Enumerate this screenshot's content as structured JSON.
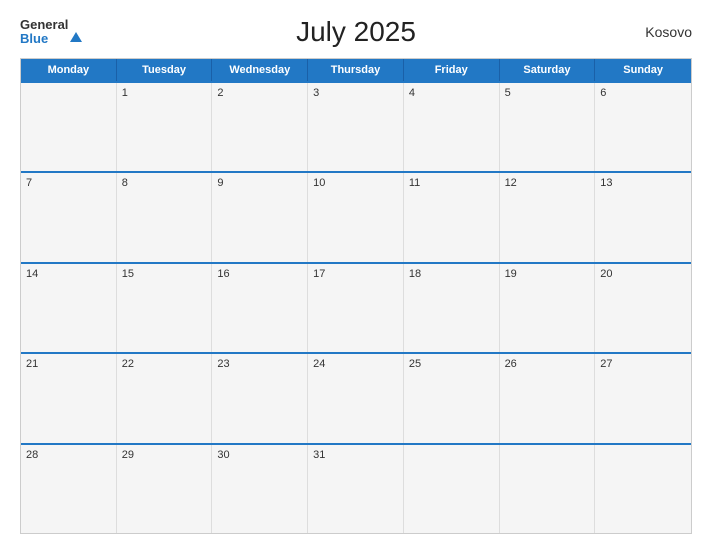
{
  "header": {
    "logo_general": "General",
    "logo_blue": "Blue",
    "title": "July 2025",
    "country": "Kosovo"
  },
  "calendar": {
    "days_of_week": [
      "Monday",
      "Tuesday",
      "Wednesday",
      "Thursday",
      "Friday",
      "Saturday",
      "Sunday"
    ],
    "weeks": [
      [
        {
          "day": ""
        },
        {
          "day": "1"
        },
        {
          "day": "2"
        },
        {
          "day": "3"
        },
        {
          "day": "4"
        },
        {
          "day": "5"
        },
        {
          "day": "6"
        }
      ],
      [
        {
          "day": "7"
        },
        {
          "day": "8"
        },
        {
          "day": "9"
        },
        {
          "day": "10"
        },
        {
          "day": "11"
        },
        {
          "day": "12"
        },
        {
          "day": "13"
        }
      ],
      [
        {
          "day": "14"
        },
        {
          "day": "15"
        },
        {
          "day": "16"
        },
        {
          "day": "17"
        },
        {
          "day": "18"
        },
        {
          "day": "19"
        },
        {
          "day": "20"
        }
      ],
      [
        {
          "day": "21"
        },
        {
          "day": "22"
        },
        {
          "day": "23"
        },
        {
          "day": "24"
        },
        {
          "day": "25"
        },
        {
          "day": "26"
        },
        {
          "day": "27"
        }
      ],
      [
        {
          "day": "28"
        },
        {
          "day": "29"
        },
        {
          "day": "30"
        },
        {
          "day": "31"
        },
        {
          "day": ""
        },
        {
          "day": ""
        },
        {
          "day": ""
        }
      ]
    ]
  }
}
